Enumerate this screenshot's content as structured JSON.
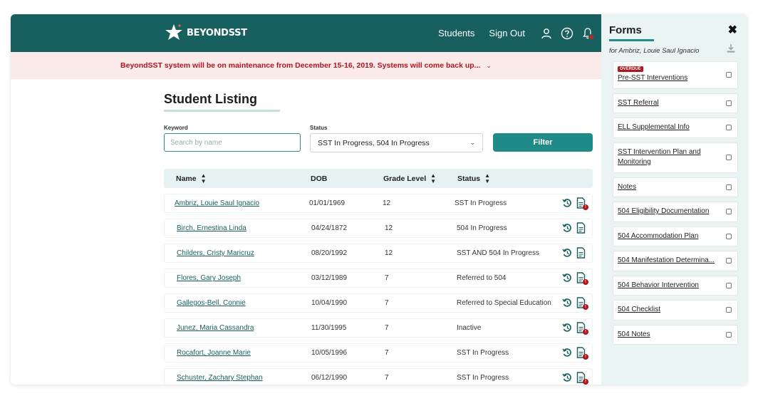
{
  "header": {
    "logo_text": "BEYONDSST",
    "nav": [
      {
        "label": "Students"
      },
      {
        "label": "Sign Out"
      }
    ],
    "icons": [
      "user-icon",
      "help-icon",
      "bell-icon"
    ],
    "colors": {
      "brand": "#17605f",
      "alert": "#b1141b",
      "accent": "#1f8a86"
    }
  },
  "banner": {
    "text": "BeyondSST system will be on maintenance from December 15-16, 2019. Systems will come back up..."
  },
  "listing": {
    "title": "Student Listing",
    "keyword_label": "Keyword",
    "keyword_placeholder": "Search by name",
    "status_label": "Status",
    "status_value": "SST In Progress, 504 In Progress",
    "filter_label": "Filter",
    "columns": [
      "Name",
      "DOB",
      "Grade Level",
      "Status"
    ],
    "rows": [
      {
        "name": "Ambriz, Louie Saul Ignacio",
        "dob": "01/01/1969",
        "grade": "12",
        "status": "SST In Progress",
        "doc_alert": true
      },
      {
        "name": "Birch, Ernestina Linda",
        "dob": "04/24/1872",
        "grade": "12",
        "status": "504 In Progress",
        "doc_alert": false
      },
      {
        "name": "Childers, Cristy Maricruz",
        "dob": "08/20/1992",
        "grade": "12",
        "status": "SST AND 504 In Progress",
        "doc_alert": false
      },
      {
        "name": "Flores, Gary Joseph",
        "dob": "03/12/1989",
        "grade": "7",
        "status": "Referred to 504",
        "doc_alert": true
      },
      {
        "name": "Gallegos-Bell, Connie",
        "dob": "10/04/1990",
        "grade": "7",
        "status": "Referred to Special Education",
        "doc_alert": true
      },
      {
        "name": "Junez, Maria Cassandra",
        "dob": "11/30/1995",
        "grade": "7",
        "status": "Inactive",
        "doc_alert": true
      },
      {
        "name": "Rocafort, Joanne Marie",
        "dob": "10/05/1996",
        "grade": "7",
        "status": "SST In Progress",
        "doc_alert": true
      },
      {
        "name": "Schuster, Zachary Stephan",
        "dob": "06/12/1990",
        "grade": "7",
        "status": "SST In Progress",
        "doc_alert": true
      }
    ]
  },
  "forms_panel": {
    "title": "Forms",
    "subtitle": "for Ambriz, Louie Saul Ignacio",
    "overdue_badge": "OVERDUE",
    "forms": [
      {
        "label": "Pre-SST Interventions",
        "overdue": true
      },
      {
        "label": "SST Referral",
        "overdue": false
      },
      {
        "label": "ELL Supplemental Info",
        "overdue": false
      },
      {
        "label": "SST Intervention Plan and Monitoring",
        "overdue": false
      },
      {
        "label": "Notes",
        "overdue": false
      },
      {
        "label": "504 Eligibility Documentation",
        "overdue": false
      },
      {
        "label": "504 Accommodation Plan",
        "overdue": false
      },
      {
        "label": "504 Manifestation Determina...",
        "overdue": false
      },
      {
        "label": "504 Behavior Intervention",
        "overdue": false
      },
      {
        "label": "504 Checklist",
        "overdue": false
      },
      {
        "label": "504 Notes",
        "overdue": false
      }
    ]
  }
}
